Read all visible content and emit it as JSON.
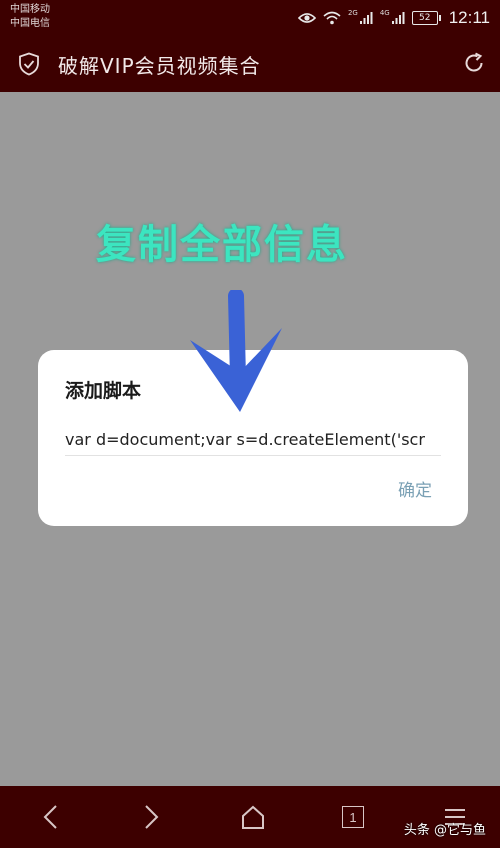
{
  "status_bar": {
    "carrier_1": "中国移动",
    "carrier_2": "中国电信",
    "net_label_1": "2G",
    "net_label_2": "4G",
    "battery": "52",
    "time": "12:11",
    "icons": [
      "eye-icon",
      "wifi-icon",
      "signal-icon",
      "signal-icon",
      "battery-icon"
    ]
  },
  "header": {
    "title": "破解VIP会员视频集合",
    "left_icon": "shield-check-icon",
    "right_icon": "refresh-icon"
  },
  "instruction": "复制全部信息",
  "dialog": {
    "title": "添加脚本",
    "script_value": "var d=document;var s=d.createElement('scr",
    "confirm_label": "确定"
  },
  "bottom_nav": {
    "items": [
      "back-icon",
      "forward-icon",
      "home-icon",
      "tabs-icon",
      "menu-icon"
    ],
    "tab_count": "1"
  },
  "watermark": "头条 @它与鱼",
  "colors": {
    "bar_background": "#3d0000",
    "overlay": "#9a9a9a",
    "instruction_text": "#3ce5c0",
    "arrow": "#3a62d6",
    "confirm_text": "#7aa0b4"
  }
}
